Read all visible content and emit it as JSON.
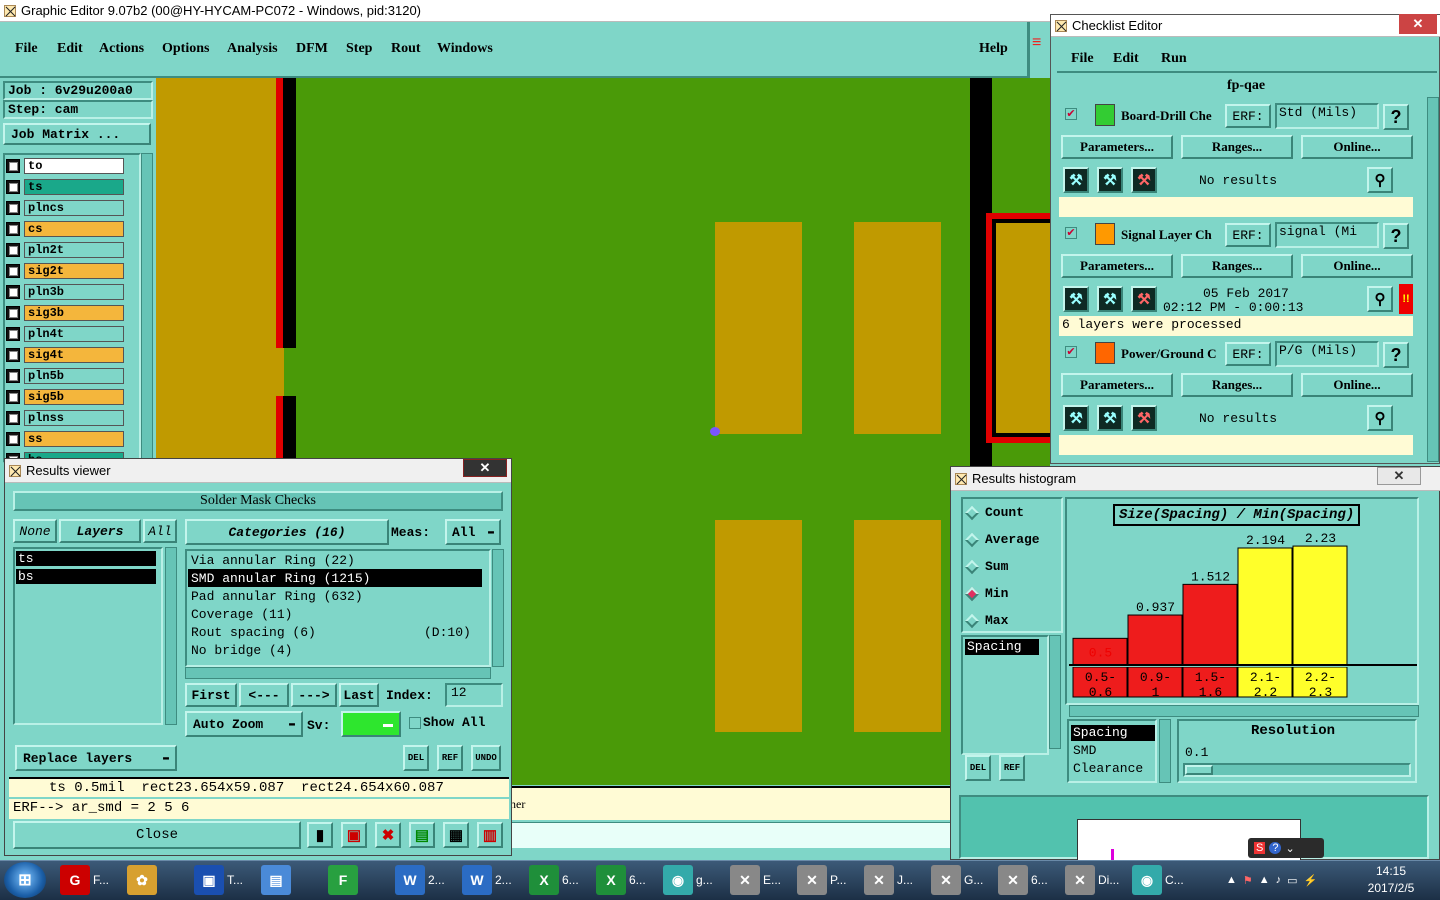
{
  "main_window": {
    "title": "Graphic Editor 9.07b2 (00@HY-HYCAM-PC072 - Windows, pid:3120)",
    "menu": [
      "File",
      "Edit",
      "Actions",
      "Options",
      "Analysis",
      "DFM",
      "Step",
      "Rout",
      "Windows"
    ],
    "help": "Help",
    "job_label": "Job : 6v29u200a0",
    "step_label": "Step: cam",
    "job_matrix": "Job Matrix ...",
    "layers": [
      {
        "name": "to",
        "color": "#ffffff"
      },
      {
        "name": "ts",
        "color": "#1aa88a"
      },
      {
        "name": "plncs",
        "color": "#7fd6c8"
      },
      {
        "name": "cs",
        "color": "#f4b63c"
      },
      {
        "name": "pln2t",
        "color": "#7fd6c8"
      },
      {
        "name": "sig2t",
        "color": "#f4b63c"
      },
      {
        "name": "pln3b",
        "color": "#7fd6c8"
      },
      {
        "name": "sig3b",
        "color": "#f4b63c"
      },
      {
        "name": "pln4t",
        "color": "#7fd6c8"
      },
      {
        "name": "sig4t",
        "color": "#f4b63c"
      },
      {
        "name": "pln5b",
        "color": "#7fd6c8"
      },
      {
        "name": "sig5b",
        "color": "#f4b63c"
      },
      {
        "name": "plnss",
        "color": "#7fd6c8"
      },
      {
        "name": "ss",
        "color": "#f4b63c"
      },
      {
        "name": "bs",
        "color": "#1aa88a"
      }
    ],
    "status_partial": "ner",
    "colors": {
      "board_green": "#4a9a08",
      "pad": "#c09a00",
      "edge_red": "#e00000"
    }
  },
  "checklist": {
    "title": "Checklist Editor",
    "menu": [
      "File",
      "Edit",
      "Run"
    ],
    "name": "fp-qae",
    "checks": [
      {
        "name": "Board-Drill Che",
        "erf_label": "ERF:",
        "erf_value": "Std (Mils)",
        "help": "?",
        "buttons": [
          "Parameters...",
          "Ranges...",
          "Online..."
        ],
        "status": "No results",
        "footer": ""
      },
      {
        "name": "Signal Layer Ch",
        "erf_label": "ERF:",
        "erf_value": "signal (Mi",
        "help": "?",
        "buttons": [
          "Parameters...",
          "Ranges...",
          "Online..."
        ],
        "status_line1": "05 Feb 2017",
        "status_line2": "02:12 PM - 0:00:13",
        "alert": "!!",
        "footer": "6 layers were processed"
      },
      {
        "name": "Power/Ground C",
        "erf_label": "ERF:",
        "erf_value": "P/G (Mils)",
        "help": "?",
        "buttons": [
          "Parameters...",
          "Ranges...",
          "Online..."
        ],
        "status": "No results",
        "footer": ""
      }
    ]
  },
  "results_viewer": {
    "title": "Results viewer",
    "header": "Solder Mask Checks",
    "tabs": [
      "None",
      "Layers",
      "All"
    ],
    "layers": [
      "ts",
      "bs"
    ],
    "categories_label": "Categories (16)",
    "meas_label": "Meas:",
    "meas_value": "All",
    "categories": [
      {
        "name": "Via annular Ring (22)",
        "extra": ""
      },
      {
        "name": "SMD annular Ring (1215)",
        "extra": ""
      },
      {
        "name": "Pad annular Ring (632)",
        "extra": ""
      },
      {
        "name": "Coverage (11)",
        "extra": ""
      },
      {
        "name": "Rout spacing (6)",
        "extra": "(D:10)"
      },
      {
        "name": "No bridge (4)",
        "extra": ""
      }
    ],
    "nav": [
      "First",
      "<---",
      "--->",
      "Last"
    ],
    "index_label": "Index:",
    "index_value": "12",
    "auto_zoom": "Auto Zoom",
    "sv_label": "Sv:",
    "show_all": "Show All",
    "replace_layers": "Replace layers",
    "small_btns": [
      "DEL",
      "REF",
      "UNDO"
    ],
    "info_line": "ts 0.5mil  rect23.654x59.087  rect24.654x60.087",
    "erf_line": "ERF--> ar_smd = 2 5 6",
    "close": "Close"
  },
  "histogram": {
    "title": "Results histogram",
    "modes": [
      "Count",
      "Average",
      "Sum",
      "Min",
      "Max"
    ],
    "selected_mode": "Min",
    "list_left": [
      "Spacing"
    ],
    "chart_title": "Size(Spacing) / Min(Spacing)",
    "chart_data": {
      "type": "bar",
      "title": "Size(Spacing) / Min(Spacing)",
      "categories": [
        "0.5-0.6",
        "0.9-1",
        "1.5-1.6",
        "2.1-2.2",
        "2.2-2.3"
      ],
      "values": [
        0.5,
        0.937,
        1.512,
        2.194,
        2.23
      ],
      "value_labels": [
        "0.5",
        "0.937",
        "1.512",
        "2.194",
        "2.23"
      ],
      "colors": [
        "#ee1c1c",
        "#ee1c1c",
        "#ee1c1c",
        "#ffff2a",
        "#ffff2a"
      ],
      "ylim": [
        0,
        2.4
      ]
    },
    "bins_line1": [
      "0.5-",
      "0.9-",
      "1.5-",
      "2.1-",
      "2.2-"
    ],
    "bins_line2": [
      "0.6",
      "1",
      "1.6",
      "2.2",
      "2.3"
    ],
    "list_bottom": [
      "Spacing",
      "SMD",
      "Clearance"
    ],
    "resolution_label": "Resolution",
    "resolution_value": "0.1",
    "small_btns": [
      "DEL",
      "REF"
    ]
  },
  "taskbar": {
    "items": [
      "F...",
      "",
      "T...",
      "",
      "",
      "2...",
      "2...",
      "6...",
      "6...",
      "g...",
      "E...",
      "P...",
      "J...",
      "G...",
      "6...",
      "Di...",
      "C..."
    ],
    "time": "14:15",
    "date": "2017/2/5"
  }
}
